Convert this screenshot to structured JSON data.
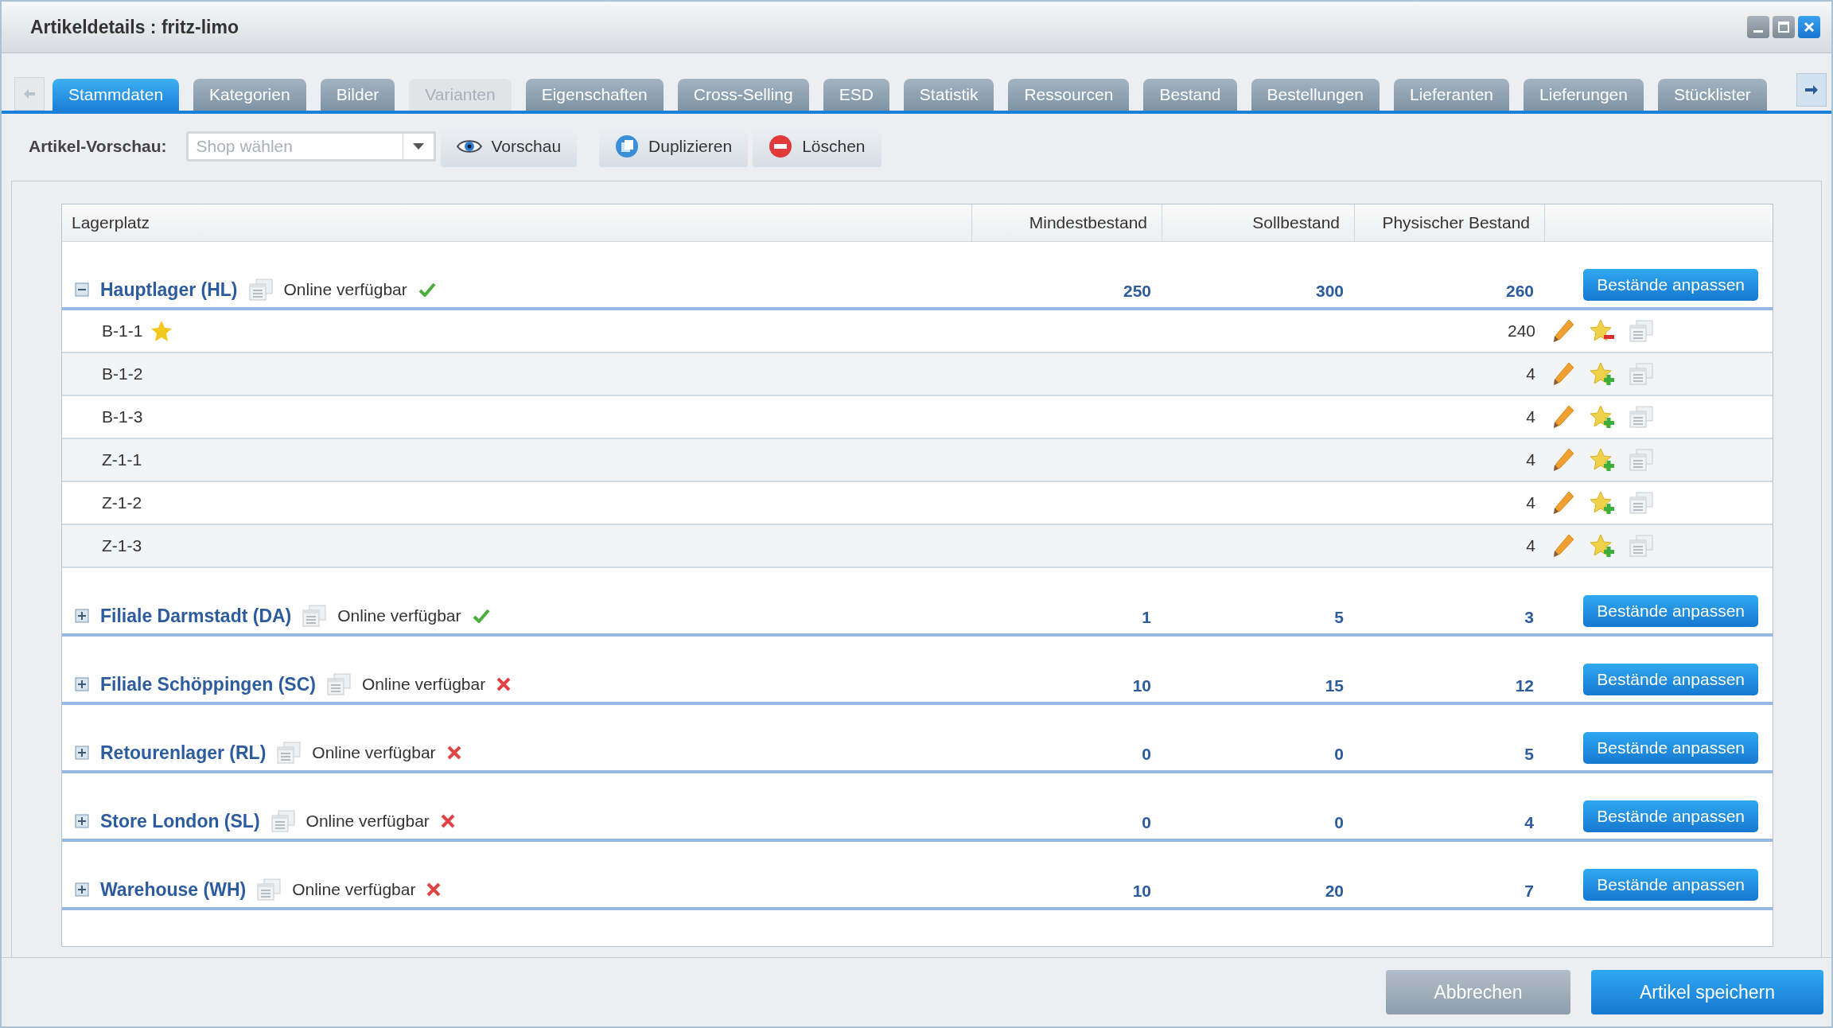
{
  "window": {
    "title": "Artikeldetails : fritz-limo"
  },
  "tabs": [
    {
      "label": "Stammdaten",
      "selected": true,
      "disabled": false
    },
    {
      "label": "Kategorien",
      "selected": false,
      "disabled": false
    },
    {
      "label": "Bilder",
      "selected": false,
      "disabled": false
    },
    {
      "label": "Varianten",
      "selected": false,
      "disabled": true
    },
    {
      "label": "Eigenschaften",
      "selected": false,
      "disabled": false
    },
    {
      "label": "Cross-Selling",
      "selected": false,
      "disabled": false
    },
    {
      "label": "ESD",
      "selected": false,
      "disabled": false
    },
    {
      "label": "Statistik",
      "selected": false,
      "disabled": false
    },
    {
      "label": "Ressourcen",
      "selected": false,
      "disabled": false
    },
    {
      "label": "Bestand",
      "selected": false,
      "disabled": false
    },
    {
      "label": "Bestellungen",
      "selected": false,
      "disabled": false
    },
    {
      "label": "Lieferanten",
      "selected": false,
      "disabled": false
    },
    {
      "label": "Lieferungen",
      "selected": false,
      "disabled": false
    },
    {
      "label": "Stücklister",
      "selected": false,
      "disabled": false
    }
  ],
  "toolbar": {
    "label": "Artikel-Vorschau:",
    "shop_select": {
      "placeholder": "Shop wählen"
    },
    "buttons": [
      {
        "kind": "preview",
        "label": "Vorschau"
      },
      {
        "kind": "duplicate",
        "label": "Duplizieren"
      },
      {
        "kind": "delete",
        "label": "Löschen"
      }
    ]
  },
  "table": {
    "columns": [
      "Lagerplatz",
      "Mindestbestand",
      "Sollbestand",
      "Physischer Bestand"
    ],
    "groups": [
      {
        "name": "Hauptlager (HL)",
        "online_label": "Online verfügbar",
        "online": true,
        "expanded": true,
        "min": "250",
        "target": "300",
        "physical": "260",
        "action": "Bestände anpassen",
        "children": [
          {
            "name": "B-1-1",
            "favorite": true,
            "physical": "240"
          },
          {
            "name": "B-1-2",
            "favorite": false,
            "physical": "4"
          },
          {
            "name": "B-1-3",
            "favorite": false,
            "physical": "4"
          },
          {
            "name": "Z-1-1",
            "favorite": false,
            "physical": "4"
          },
          {
            "name": "Z-1-2",
            "favorite": false,
            "physical": "4"
          },
          {
            "name": "Z-1-3",
            "favorite": false,
            "physical": "4"
          }
        ]
      },
      {
        "name": "Filiale Darmstadt (DA)",
        "online_label": "Online verfügbar",
        "online": true,
        "expanded": false,
        "min": "1",
        "target": "5",
        "physical": "3",
        "action": "Bestände anpassen"
      },
      {
        "name": "Filiale Schöppingen (SC)",
        "online_label": "Online verfügbar",
        "online": false,
        "expanded": false,
        "min": "10",
        "target": "15",
        "physical": "12",
        "action": "Bestände anpassen"
      },
      {
        "name": "Retourenlager (RL)",
        "online_label": "Online verfügbar",
        "online": false,
        "expanded": false,
        "min": "0",
        "target": "0",
        "physical": "5",
        "action": "Bestände anpassen"
      },
      {
        "name": "Store London (SL)",
        "online_label": "Online verfügbar",
        "online": false,
        "expanded": false,
        "min": "0",
        "target": "0",
        "physical": "4",
        "action": "Bestände anpassen"
      },
      {
        "name": "Warehouse (WH)",
        "online_label": "Online verfügbar",
        "online": false,
        "expanded": false,
        "min": "10",
        "target": "20",
        "physical": "7",
        "action": "Bestände anpassen"
      }
    ]
  },
  "footer": {
    "buttons": [
      {
        "kind": "secondary",
        "label": "Abbrechen"
      },
      {
        "kind": "primary",
        "label": "Artikel speichern"
      }
    ]
  }
}
